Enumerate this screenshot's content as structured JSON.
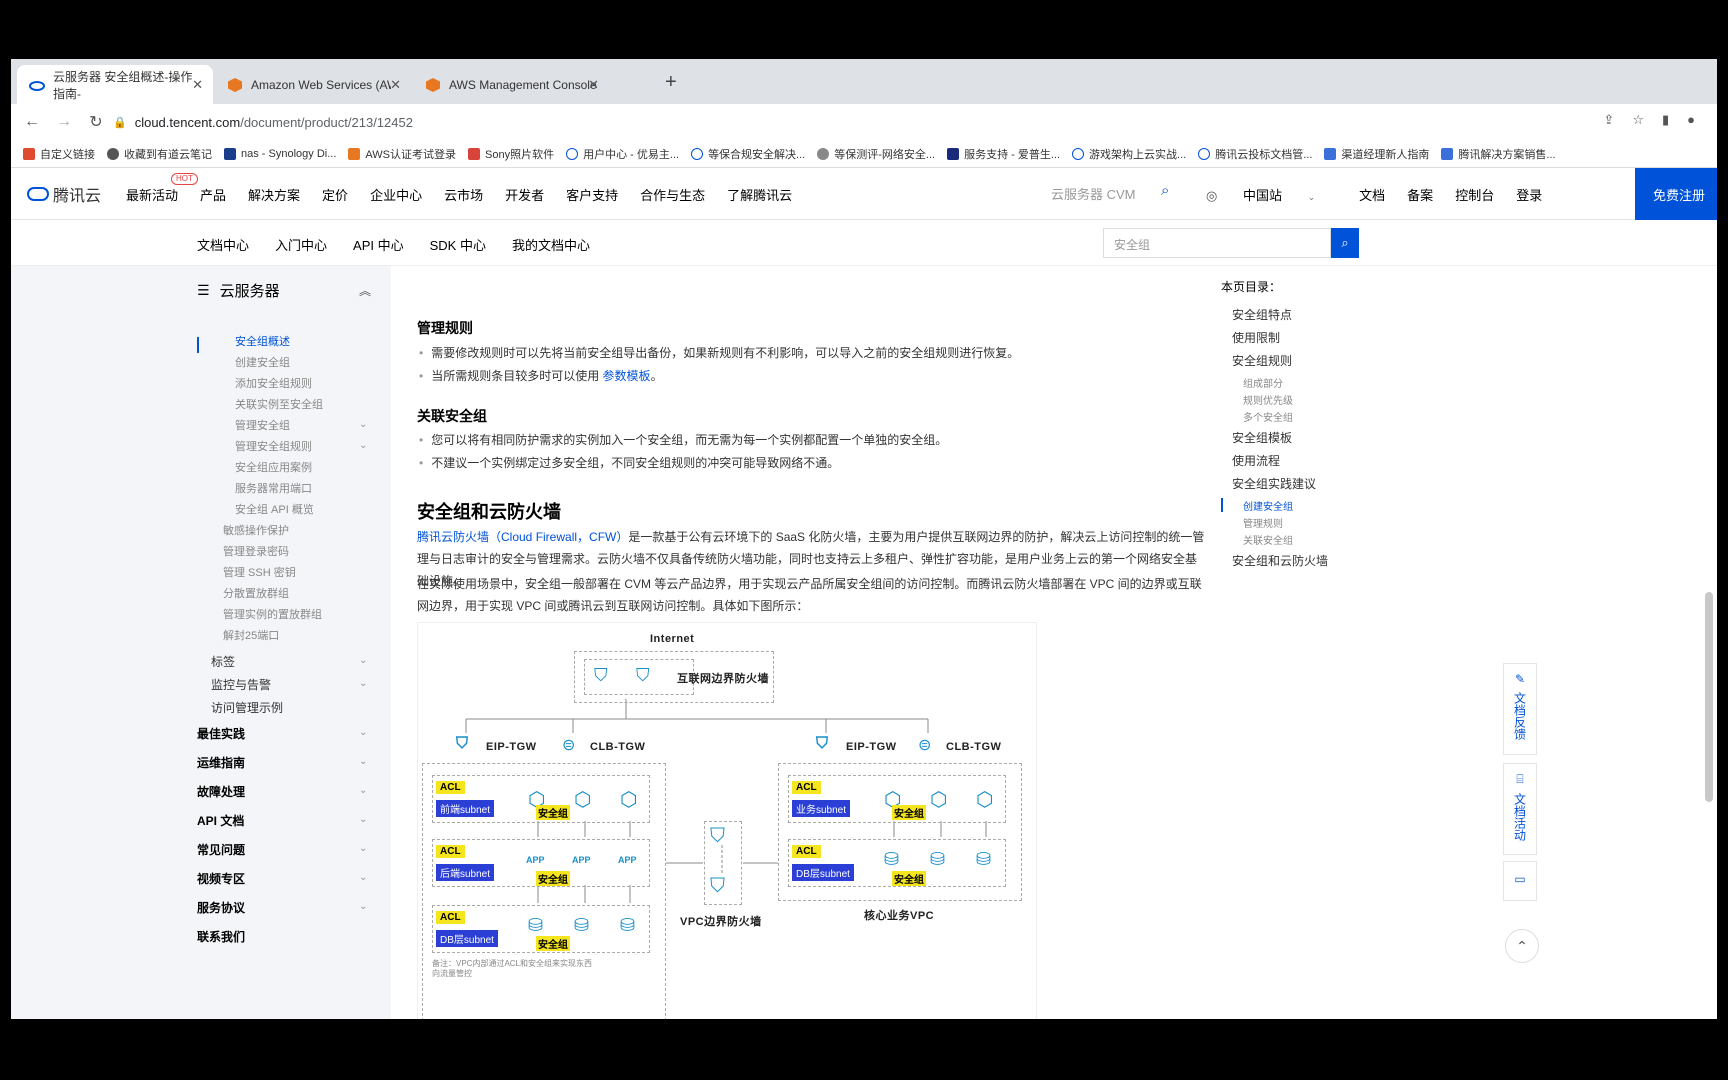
{
  "browser": {
    "tabs": [
      {
        "label": "云服务器 安全组概述-操作指南-",
        "active": true
      },
      {
        "label": "Amazon Web Services (AWS) 云",
        "active": false
      },
      {
        "label": "AWS Management Console",
        "active": false
      }
    ],
    "url_host": "cloud.tencent.com",
    "url_path": "/document/product/213/12452",
    "bookmarks": [
      "自定义链接",
      "收藏到有道云笔记",
      "nas - Synology Di...",
      "AWS认证考试登录",
      "Sony照片软件",
      "用户中心 - 优易主...",
      "等保合规安全解决...",
      "等保测评-网络安全...",
      "服务支持 - 爱普生...",
      "游戏架构上云实战...",
      "腾讯云投标文档管...",
      "渠道经理新人指南",
      "腾讯解决方案销售..."
    ]
  },
  "site": {
    "logo": "腾讯云",
    "hot": "HOT",
    "nav": [
      "最新活动",
      "产品",
      "解决方案",
      "定价",
      "企业中心",
      "云市场",
      "开发者",
      "客户支持",
      "合作与生态",
      "了解腾讯云"
    ],
    "search_placeholder": "云服务器 CVM",
    "region": "中国站",
    "right_links": [
      "文档",
      "备案",
      "控制台",
      "登录"
    ],
    "register": "免费注册"
  },
  "subnav": {
    "items": [
      "文档中心",
      "入门中心",
      "API 中心",
      "SDK 中心",
      "我的文档中心"
    ],
    "search_placeholder": "安全组"
  },
  "sidebar": {
    "title": "云服务器",
    "items": [
      {
        "label": "安全组概述",
        "level": "l3",
        "active": true
      },
      {
        "label": "创建安全组",
        "level": "l3"
      },
      {
        "label": "添加安全组规则",
        "level": "l3"
      },
      {
        "label": "关联实例至安全组",
        "level": "l3"
      },
      {
        "label": "管理安全组",
        "level": "l3",
        "chev": true
      },
      {
        "label": "管理安全组规则",
        "level": "l3",
        "chev": true
      },
      {
        "label": "安全组应用案例",
        "level": "l3"
      },
      {
        "label": "服务器常用端口",
        "level": "l3"
      },
      {
        "label": "安全组 API 概览",
        "level": "l3"
      },
      {
        "label": "敏感操作保护",
        "level": "l3b"
      },
      {
        "label": "管理登录密码",
        "level": "l3b"
      },
      {
        "label": "管理 SSH 密钥",
        "level": "l3b"
      },
      {
        "label": "分散置放群组",
        "level": "l3b"
      },
      {
        "label": "管理实例的置放群组",
        "level": "l3b"
      },
      {
        "label": "解封25端口",
        "level": "l3b"
      },
      {
        "label": "标签",
        "level": "l2",
        "chev": true
      },
      {
        "label": "监控与告警",
        "level": "l2",
        "chev": true
      },
      {
        "label": "访问管理示例",
        "level": "l2"
      },
      {
        "label": "最佳实践",
        "level": "l1",
        "chev": true
      },
      {
        "label": "运维指南",
        "level": "l1",
        "chev": true
      },
      {
        "label": "故障处理",
        "level": "l1",
        "chev": true
      },
      {
        "label": "API 文档",
        "level": "l1",
        "chev": true
      },
      {
        "label": "常见问题",
        "level": "l1",
        "chev": true
      },
      {
        "label": "视频专区",
        "level": "l1",
        "chev": true
      },
      {
        "label": "服务协议",
        "level": "l1",
        "chev": true
      },
      {
        "label": "联系我们",
        "level": "l1"
      }
    ]
  },
  "content": {
    "h_manage": "管理规则",
    "manage_items": [
      "需要修改规则时可以先将当前安全组导出备份，如果新规则有不利影响，可以导入之前的安全组规则进行恢复。",
      "当所需规则条目较多时可以使用 "
    ],
    "param_link": "参数模板",
    "period": "。",
    "h_assoc": "关联安全组",
    "assoc_items": [
      "您可以将有相同防护需求的实例加入一个安全组，而无需为每一个实例都配置一个单独的安全组。",
      "不建议一个实例绑定过多安全组，不同安全组规则的冲突可能导致网络不通。"
    ],
    "h_fw": "安全组和云防火墙",
    "p1_link": "腾讯云防火墙（Cloud Firewall，CFW）",
    "p1_text": "是一款基于公有云环境下的 SaaS 化防火墙，主要为用户提供互联网边界的防护，解决云上访问控制的统一管理与日志审计的安全与管理需求。云防火墙不仅具备传统防火墙功能，同时也支持云上多租户、弹性扩容功能，是用户业务上云的第一个网络安全基础设施。",
    "p2": "在实际使用场景中，安全组一般部署在 CVM 等云产品边界，用于实现云产品所属安全组间的访问控制。而腾讯云防火墙部署在 VPC 间的边界或互联网边界，用于实现 VPC 间或腾讯云到互联网访问控制。具体如下图所示："
  },
  "diagram": {
    "internet": "Internet",
    "inet_fw": "互联网边界防火墙",
    "eip": "EIP-TGW",
    "clb": "CLB-TGW",
    "acl": "ACL",
    "sg": "安全组",
    "left_subnets": [
      "前端subnet",
      "后端subnet",
      "DB层subnet"
    ],
    "right_subnets": [
      "业务subnet",
      "DB层subnet"
    ],
    "vpc_fw": "VPC边界防火墙",
    "core_vpc": "核心业务VPC",
    "note": "备注：VPC内部通过ACL和安全组来实现东西向流量管控",
    "app": "APP"
  },
  "toc": {
    "title": "本页目录：",
    "items": [
      {
        "label": "安全组特点"
      },
      {
        "label": "使用限制"
      },
      {
        "label": "安全组规则"
      },
      {
        "label": "组成部分",
        "sub": true
      },
      {
        "label": "规则优先级",
        "sub": true
      },
      {
        "label": "多个安全组",
        "sub": true
      },
      {
        "label": "安全组模板"
      },
      {
        "label": "使用流程"
      },
      {
        "label": "安全组实践建议"
      },
      {
        "label": "创建安全组",
        "sub": true,
        "active": true
      },
      {
        "label": "管理规则",
        "sub": true
      },
      {
        "label": "关联安全组",
        "sub": true
      },
      {
        "label": "安全组和云防火墙"
      }
    ]
  },
  "floats": {
    "feedback": "文档反馈",
    "activity": "文档活动"
  },
  "colors": {
    "brand": "#0052d9",
    "acl": "#f5e51e",
    "subnet": "#2b3fd6"
  }
}
